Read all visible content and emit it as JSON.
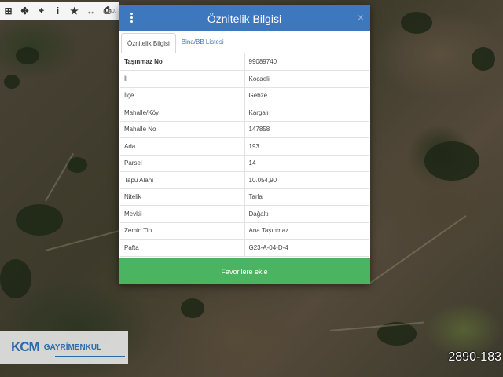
{
  "toolbar": {
    "tools": [
      {
        "icon": "info-icon-grid",
        "glyph": "⊞"
      },
      {
        "icon": "pan-icon",
        "glyph": "✤"
      },
      {
        "icon": "crosshair-icon",
        "glyph": "⌖"
      },
      {
        "icon": "info-icon",
        "glyph": "i"
      },
      {
        "icon": "star-icon",
        "glyph": "★"
      },
      {
        "icon": "measure-icon",
        "glyph": "↔"
      },
      {
        "icon": "print-icon",
        "glyph": "⎙"
      }
    ],
    "coordinate_text": "40."
  },
  "modal": {
    "title": "Öznitelik Bilgisi",
    "close_label": "×",
    "tabs": [
      {
        "label": "Öznitelik Bilgisi",
        "active": true
      },
      {
        "label": "Bina/BB Listesi",
        "active": false
      }
    ],
    "rows": [
      {
        "key": "Taşınmaz No",
        "value": "99089740"
      },
      {
        "key": "İl",
        "value": "Kocaeli"
      },
      {
        "key": "İlçe",
        "value": "Gebze"
      },
      {
        "key": "Mahalle/Köy",
        "value": "Kargalı"
      },
      {
        "key": "Mahalle No",
        "value": "147858"
      },
      {
        "key": "Ada",
        "value": "193"
      },
      {
        "key": "Parsel",
        "value": "14"
      },
      {
        "key": "Tapu Alanı",
        "value": "10.054,90"
      },
      {
        "key": "Nitelik",
        "value": "Tarla"
      },
      {
        "key": "Mevkii",
        "value": "Dağaltı"
      },
      {
        "key": "Zemin Tip",
        "value": "Ana Taşınmaz"
      },
      {
        "key": "Pafta",
        "value": "G23-A-04-D-4"
      }
    ],
    "favorite_button": "Favorilere ekle"
  },
  "logo": {
    "mark": "KCM",
    "text": "GAYRİMENKUL"
  },
  "listing_number": "2890-183",
  "colors": {
    "header": "#3d78bf",
    "favorite": "#4ab460",
    "logo": "#2e6aa8"
  }
}
